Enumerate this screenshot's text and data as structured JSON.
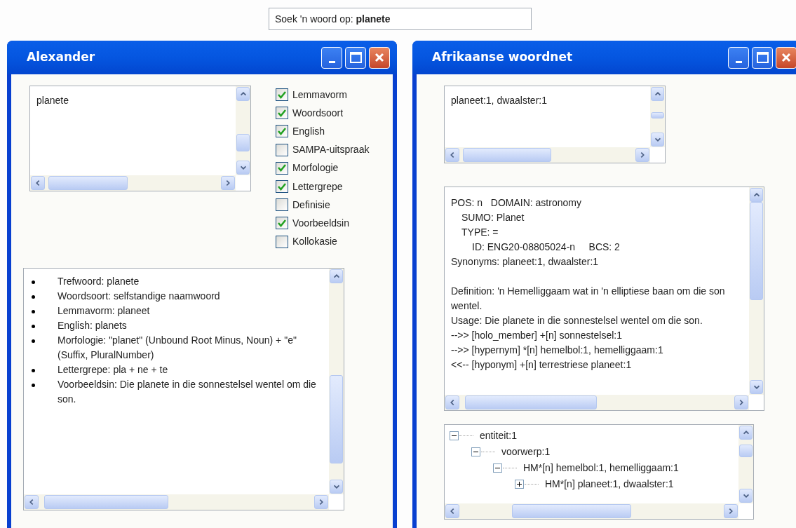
{
  "search": {
    "text": "Soek 'n woord op: **planete**"
  },
  "left_window": {
    "title": "Alexander",
    "word_list": [
      "planete"
    ],
    "options": [
      {
        "label": "Lemmavorm",
        "checked": true
      },
      {
        "label": "Woordsoort",
        "checked": true
      },
      {
        "label": "English",
        "checked": true
      },
      {
        "label": "SAMPA-uitspraak",
        "checked": false
      },
      {
        "label": "Morfologie",
        "checked": true
      },
      {
        "label": "Lettergrepe",
        "checked": true
      },
      {
        "label": "Definisie",
        "checked": false
      },
      {
        "label": "Voorbeeldsin",
        "checked": true
      },
      {
        "label": "Kollokasie",
        "checked": false
      }
    ],
    "details": [
      "Trefwoord: planete",
      "Woordsoort: selfstandige naamwoord",
      "Lemmavorm: planeet",
      "English: planets",
      "Morfologie: \"planet\" (Unbound Root Minus, Noun) + \"e\" (Suffix, PluralNumber)",
      "Lettergrepe: pla + ne + te",
      "Voorbeeldsin: Die planete in die sonnestelsel wentel om die son."
    ]
  },
  "right_window": {
    "title": "Afrikaanse woordnet",
    "synsets": [
      "planeet:1, dwaalster:1"
    ],
    "header": {
      "text": "POS: n   DOMAIN: astronomy",
      "children": [
        {
          "text": "SUMO: Planet"
        },
        {
          "text": "TYPE: =",
          "children": [
            {
              "text": "ID: ENG20-08805024-n     BCS: 2"
            }
          ]
        }
      ]
    },
    "synonyms": "Synonyms: planeet:1, dwaalster:1",
    "lines": [
      "Definition: 'n Hemelliggaam wat in 'n elliptiese baan om die son wentel.",
      "Usage: Die planete in die sonnestelsel wentel om die son.",
      "-->> [holo_member] +[n] sonnestelsel:1",
      "-->> [hypernym] *[n] hemelbol:1, hemelliggaam:1",
      "<<-- [hyponym] +[n] terrestriese planeet:1"
    ],
    "tree": [
      {
        "label": "entiteit:1",
        "expanded": true,
        "children": [
          {
            "label": "voorwerp:1",
            "expanded": true,
            "children": [
              {
                "label": "HM*[n] hemelbol:1, hemelliggaam:1",
                "expanded": true,
                "children": [
                  {
                    "label": "HM*[n] planeet:1, dwaalster:1",
                    "expanded": false
                  }
                ]
              }
            ]
          }
        ]
      }
    ]
  }
}
